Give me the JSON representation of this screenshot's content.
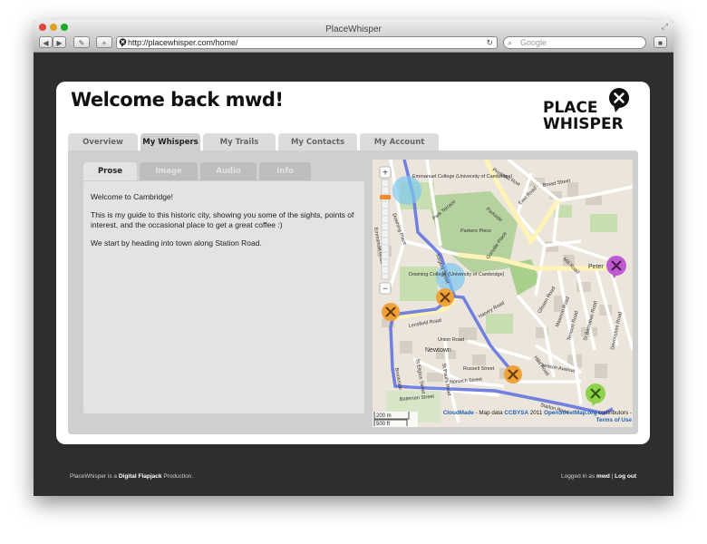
{
  "browser": {
    "title": "PlaceWhisper",
    "url": "http://placewhisper.com/home/",
    "search_placeholder": "Google"
  },
  "header": {
    "welcome": "Welcome back mwd!",
    "logo_line1": "PLACE",
    "logo_line2": "WHISPER"
  },
  "tabs": [
    "Overview",
    "My Whispers",
    "My Trails",
    "My Contacts",
    "My Account"
  ],
  "active_tab": "My Whispers",
  "subtabs": [
    "Prose",
    "Image",
    "Audio",
    "Info"
  ],
  "active_subtab": "Prose",
  "prose": {
    "p1": "Welcome to Cambridge!",
    "p2": "This is my guide to this historic city, showing you some of the sights, points of interest, and the occasional place to get a great coffee :)",
    "p3": "We start by heading into town along Station Road."
  },
  "map": {
    "labels": {
      "emmanuel": "Emmanuel College (University of Cambridge)",
      "downing": "Downing College (University of Cambridge)",
      "parkers": "Parkers Piece",
      "newtown": "Newtown",
      "park_terrace": "Park Terrace",
      "parkside": "Parkside",
      "east_road": "East Road",
      "prospect_row": "Prospect Row",
      "broad_street": "Broad Street",
      "gonville_place": "Gonville Place",
      "mill_road": "Mill Road",
      "peter": "Peter",
      "lensfield_road": "Lensfield Road",
      "harvey_road": "Harvey Road",
      "union_road": "Union Road",
      "russell_street": "Russell Street",
      "norwich_street": "Norwich Street",
      "bateman_street": "Bateman Street",
      "station_road": "Station Road",
      "hills_road": "Hills Road",
      "tenison_avenue": "Tenison Avenue",
      "glisson_road": "Glisson Road",
      "mawson_road": "Mawson Road",
      "tenison_road": "Tenison Road",
      "st_barnabas": "St Barnabas Road",
      "devonshire": "Devonshire Road",
      "brookside": "Brookside",
      "st_eligius": "St Eligius Street",
      "st_pauls": "St Paul's Road",
      "downing_place": "Downing Place",
      "regent_street": "Regent Street",
      "emmanuel_road": "Emmanuel Road"
    },
    "scale_m": "200 m",
    "scale_ft": "500 ft",
    "attribution_prefix": "CloudMade",
    "attribution_mid": " - Map data ",
    "attribution_license": "CCBYSA",
    "attribution_year": " 2011 ",
    "attribution_osm": "OpenStreetMap.org",
    "attribution_tail": " contributors -",
    "terms": "Terms of Use",
    "zoom_in": "+",
    "zoom_out": "−"
  },
  "footer": {
    "left_prefix": "PlaceWhisper is a ",
    "left_brand": "Digital Flapjack",
    "left_suffix": " Production.",
    "right_prefix": "Logged in as ",
    "right_user": "mwd",
    "right_sep": " | ",
    "right_logout": "Log out"
  },
  "colors": {
    "route": "#5a6fe0",
    "park": "#b5d29e",
    "marker_orange": "#f0a23a",
    "marker_purple": "#c05ad0",
    "marker_green": "#8fd14a",
    "circle_blue": "#7ec8f0"
  }
}
